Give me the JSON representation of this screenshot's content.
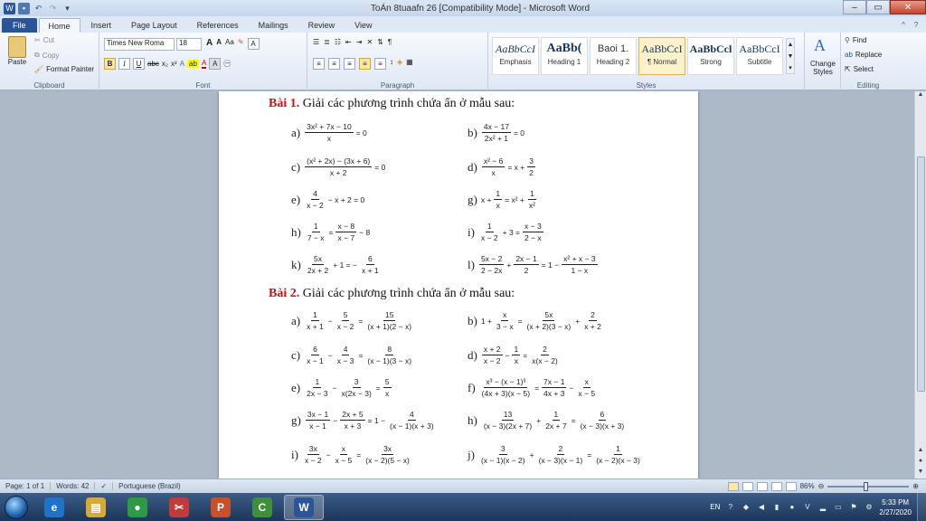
{
  "window": {
    "title": "ToÁn 8tuaafn 26 [Compatibility Mode] - Microsoft Word",
    "app_icon": "word-icon",
    "qat": [
      "save-icon",
      "undo-icon",
      "redo-icon",
      "customize-icon"
    ],
    "controls": [
      "–",
      "▭",
      "✕"
    ]
  },
  "tabs": [
    "File",
    "Home",
    "Insert",
    "Page Layout",
    "References",
    "Mailings",
    "Review",
    "View"
  ],
  "active_tab": "Home",
  "ribbon": {
    "clipboard": {
      "paste": "Paste",
      "cut": "Cut",
      "copy": "Copy",
      "format_painter": "Format Painter",
      "label": "Clipboard"
    },
    "font": {
      "font_name": "Times New Roma",
      "font_size": "18",
      "grow": "A",
      "shrink": "A",
      "case": "Aa",
      "bold": "B",
      "italic": "I",
      "underline": "U",
      "strike": "abc",
      "sub": "x₂",
      "sup": "x²",
      "label": "Font"
    },
    "paragraph": {
      "label": "Paragraph",
      "pilcrow": "¶"
    },
    "styles": {
      "label": "Styles",
      "items": [
        {
          "sample": "AaBbCcI",
          "name": "Emphasis"
        },
        {
          "sample": "AaBb(",
          "name": "Heading 1"
        },
        {
          "sample": "Baoi 1.",
          "name": "Heading 2"
        },
        {
          "sample": "AaBbCcI",
          "name": "¶ Normal"
        },
        {
          "sample": "AaBbCcl",
          "name": "Strong"
        },
        {
          "sample": "AaBbCcI",
          "name": "Subtitle"
        }
      ],
      "change_styles": "Change Styles"
    },
    "editing": {
      "find": "Find",
      "replace": "Replace",
      "select": "Select",
      "label": "Editing"
    }
  },
  "document": {
    "bai1": {
      "num": "Bài 1.",
      "text": "Giải các phương trình chứa ẩn ở mẫu sau:"
    },
    "bai2": {
      "num": "Bài 2.",
      "text": "Giải các phương trình chứa ẩn ở mẫu sau:"
    },
    "eq1": [
      {
        "label": "a)",
        "parts": [
          {
            "n": "3x² + 7x − 10",
            "d": "x"
          },
          {
            "t": "= 0"
          }
        ]
      },
      {
        "label": "b)",
        "parts": [
          {
            "n": "4x − 17",
            "d": "2x² + 1"
          },
          {
            "t": "= 0"
          }
        ]
      },
      {
        "label": "c)",
        "parts": [
          {
            "n": "(x² + 2x) − (3x + 6)",
            "d": "x + 2"
          },
          {
            "t": "= 0"
          }
        ]
      },
      {
        "label": "d)",
        "parts": [
          {
            "n": "x² − 6",
            "d": "x"
          },
          {
            "t": "= x +"
          },
          {
            "n": "3",
            "d": "2"
          }
        ]
      },
      {
        "label": "e)",
        "parts": [
          {
            "n": "4",
            "d": "x − 2"
          },
          {
            "t": "− x + 2 = 0"
          }
        ]
      },
      {
        "label": "g)",
        "parts": [
          {
            "t": "x +"
          },
          {
            "n": "1",
            "d": "x"
          },
          {
            "t": "= x² +"
          },
          {
            "n": "1",
            "d": "x²"
          }
        ]
      },
      {
        "label": "h)",
        "parts": [
          {
            "n": "1",
            "d": "7 − x"
          },
          {
            "t": "="
          },
          {
            "n": "x − 8",
            "d": "x − 7"
          },
          {
            "t": "− 8"
          }
        ]
      },
      {
        "label": "i)",
        "parts": [
          {
            "n": "1",
            "d": "x − 2"
          },
          {
            "t": "+ 3 ="
          },
          {
            "n": "x − 3",
            "d": "2 − x"
          }
        ]
      },
      {
        "label": "k)",
        "parts": [
          {
            "n": "5x",
            "d": "2x + 2"
          },
          {
            "t": "+ 1 = −"
          },
          {
            "n": "6",
            "d": "x + 1"
          }
        ]
      },
      {
        "label": "l)",
        "parts": [
          {
            "n": "5x − 2",
            "d": "2 − 2x"
          },
          {
            "t": "+"
          },
          {
            "n": "2x − 1",
            "d": "2"
          },
          {
            "t": "= 1 −"
          },
          {
            "n": "x² + x − 3",
            "d": "1 − x"
          }
        ]
      }
    ],
    "eq2": [
      {
        "label": "a)",
        "parts": [
          {
            "n": "1",
            "d": "x + 1"
          },
          {
            "t": "−"
          },
          {
            "n": "5",
            "d": "x − 2"
          },
          {
            "t": "="
          },
          {
            "n": "15",
            "d": "(x + 1)(2 − x)"
          }
        ]
      },
      {
        "label": "b)",
        "parts": [
          {
            "t": "1 +"
          },
          {
            "n": "x",
            "d": "3 − x"
          },
          {
            "t": "="
          },
          {
            "n": "5x",
            "d": "(x + 2)(3 − x)"
          },
          {
            "t": "+"
          },
          {
            "n": "2",
            "d": "x + 2"
          }
        ]
      },
      {
        "label": "c)",
        "parts": [
          {
            "n": "6",
            "d": "x − 1"
          },
          {
            "t": "−"
          },
          {
            "n": "4",
            "d": "x − 3"
          },
          {
            "t": "="
          },
          {
            "n": "8",
            "d": "(x − 1)(3 − x)"
          }
        ]
      },
      {
        "label": "d)",
        "parts": [
          {
            "n": "x + 2",
            "d": "x − 2"
          },
          {
            "t": "−"
          },
          {
            "n": "1",
            "d": "x"
          },
          {
            "t": "="
          },
          {
            "n": "2",
            "d": "x(x − 2)"
          }
        ]
      },
      {
        "label": "e)",
        "parts": [
          {
            "n": "1",
            "d": "2x − 3"
          },
          {
            "t": "−"
          },
          {
            "n": "3",
            "d": "x(2x − 3)"
          },
          {
            "t": "="
          },
          {
            "n": "5",
            "d": "x"
          }
        ]
      },
      {
        "label": "f)",
        "parts": [
          {
            "n": "x³ − (x − 1)³",
            "d": "(4x + 3)(x − 5)"
          },
          {
            "t": "="
          },
          {
            "n": "7x − 1",
            "d": "4x + 3"
          },
          {
            "t": "−"
          },
          {
            "n": "x",
            "d": "x − 5"
          }
        ]
      },
      {
        "label": "g)",
        "parts": [
          {
            "n": "3x − 1",
            "d": "x − 1"
          },
          {
            "t": "−"
          },
          {
            "n": "2x + 5",
            "d": "x + 3"
          },
          {
            "t": "= 1 −"
          },
          {
            "n": "4",
            "d": "(x − 1)(x + 3)"
          }
        ]
      },
      {
        "label": "h)",
        "parts": [
          {
            "n": "13",
            "d": "(x − 3)(2x + 7)"
          },
          {
            "t": "+"
          },
          {
            "n": "1",
            "d": "2x + 7"
          },
          {
            "t": "="
          },
          {
            "n": "6",
            "d": "(x − 3)(x + 3)"
          }
        ]
      },
      {
        "label": "i)",
        "parts": [
          {
            "n": "3x",
            "d": "x − 2"
          },
          {
            "t": "−"
          },
          {
            "n": "x",
            "d": "x − 5"
          },
          {
            "t": "="
          },
          {
            "n": "3x",
            "d": "(x − 2)(5 − x)"
          }
        ]
      },
      {
        "label": "j)",
        "parts": [
          {
            "n": "3",
            "d": "(x − 1)(x − 2)"
          },
          {
            "t": "+"
          },
          {
            "n": "2",
            "d": "(x − 3)(x − 1)"
          },
          {
            "t": "="
          },
          {
            "n": "1",
            "d": "(x − 2)(x − 3)"
          }
        ]
      }
    ]
  },
  "status": {
    "page": "Page: 1 of 1",
    "words": "Words: 42",
    "language": "Portuguese (Brazil)",
    "zoom": "86%"
  },
  "taskbar": {
    "apps": [
      {
        "name": "ie",
        "glyph": "e",
        "color": "#1e73c8"
      },
      {
        "name": "explorer",
        "glyph": "▤",
        "color": "#d7a93a"
      },
      {
        "name": "chrome",
        "glyph": "●",
        "color": "#2e9a45"
      },
      {
        "name": "snipping",
        "glyph": "✂",
        "color": "#c23b3b"
      },
      {
        "name": "powerpoint",
        "glyph": "P",
        "color": "#c8502a"
      },
      {
        "name": "camtasia",
        "glyph": "C",
        "color": "#3f8f3f"
      },
      {
        "name": "word",
        "glyph": "W",
        "color": "#2a5699"
      }
    ],
    "lang": "EN",
    "time": "5:33 PM",
    "date": "2/27/2020"
  }
}
